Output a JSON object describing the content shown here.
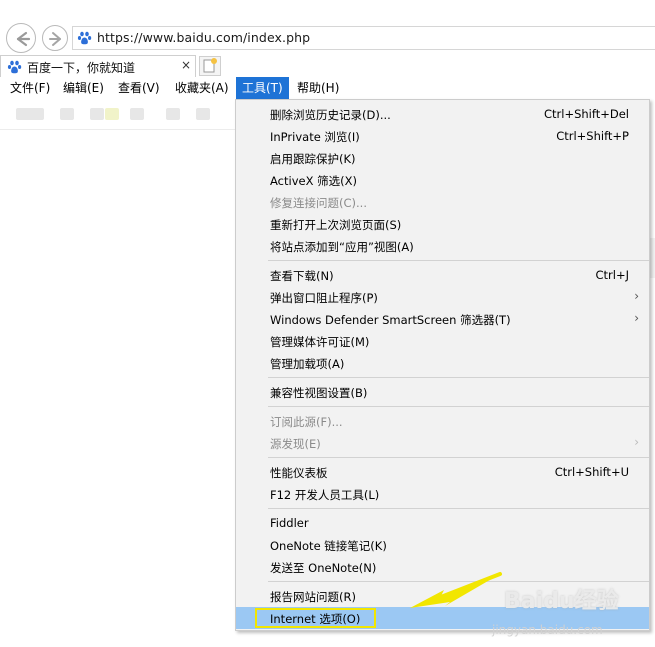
{
  "browser": {
    "url": "https://www.baidu.com/index.php",
    "tab_title": "百度一下，你就知道",
    "tab_close": "×"
  },
  "menubar": {
    "items": [
      {
        "label": "文件(F)"
      },
      {
        "label": "编辑(E)"
      },
      {
        "label": "查看(V)"
      },
      {
        "label": "收藏夹(A)"
      },
      {
        "label": "工具(T)",
        "active": true
      },
      {
        "label": "帮助(H)"
      }
    ]
  },
  "tools_menu": {
    "items": [
      {
        "label": "删除浏览历史记录(D)...",
        "shortcut": "Ctrl+Shift+Del"
      },
      {
        "label": "InPrivate 浏览(I)",
        "shortcut": "Ctrl+Shift+P"
      },
      {
        "label": "启用跟踪保护(K)",
        "shortcut": ""
      },
      {
        "label": "ActiveX 筛选(X)",
        "shortcut": ""
      },
      {
        "label": "修复连接问题(C)...",
        "shortcut": "",
        "disabled": true
      },
      {
        "label": "重新打开上次浏览页面(S)",
        "shortcut": ""
      },
      {
        "label": "将站点添加到“应用”视图(A)",
        "shortcut": ""
      },
      {
        "label": "查看下载(N)",
        "shortcut": "Ctrl+J"
      },
      {
        "label": "弹出窗口阻止程序(P)",
        "shortcut": "",
        "submenu": true
      },
      {
        "label": "Windows Defender SmartScreen 筛选器(T)",
        "shortcut": "",
        "submenu": true
      },
      {
        "label": "管理媒体许可证(M)",
        "shortcut": ""
      },
      {
        "label": "管理加载项(A)",
        "shortcut": ""
      },
      {
        "label": "兼容性视图设置(B)",
        "shortcut": ""
      },
      {
        "label": "订阅此源(F)...",
        "shortcut": "",
        "disabled": true
      },
      {
        "label": "源发现(E)",
        "shortcut": "",
        "disabled": true,
        "submenu": true
      },
      {
        "label": "性能仪表板",
        "shortcut": "Ctrl+Shift+U"
      },
      {
        "label": "F12 开发人员工具(L)",
        "shortcut": ""
      },
      {
        "label": "Fiddler",
        "shortcut": ""
      },
      {
        "label": "OneNote 链接笔记(K)",
        "shortcut": ""
      },
      {
        "label": "发送至 OneNote(N)",
        "shortcut": ""
      },
      {
        "label": "报告网站问题(R)",
        "shortcut": ""
      },
      {
        "label": "Internet 选项(O)",
        "shortcut": "",
        "highlighted": true
      }
    ],
    "submenu_arrow": "›"
  },
  "watermark": {
    "brand": "Baidu经验",
    "site": "jingyan.baidu.com"
  },
  "colors": {
    "menu_active": "#1e73d6",
    "highlight_row": "#9bc8f3",
    "highlight_box": "#f2e600",
    "annotation_arrow": "#f2e600"
  },
  "icons": [
    "back-arrow-icon",
    "forward-arrow-icon",
    "baidu-paw-icon",
    "new-tab-icon",
    "submenu-chevron-icon"
  ]
}
